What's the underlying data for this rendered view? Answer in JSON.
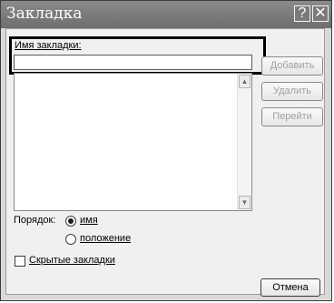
{
  "window": {
    "title": "Закладка",
    "help_glyph": "?",
    "close_glyph": "✕"
  },
  "bookmark_name": {
    "label": "Имя закладки:",
    "value": ""
  },
  "buttons": {
    "add": "Добавить",
    "delete": "Удалить",
    "goto": "Перейти",
    "cancel": "Отмена"
  },
  "sort": {
    "label": "Порядок:",
    "options": [
      {
        "label": "имя",
        "selected": true
      },
      {
        "label": "положение",
        "selected": false
      }
    ]
  },
  "hidden_bookmarks": {
    "label": "Скрытые закладки",
    "checked": false
  },
  "scrollbar": {
    "up_glyph": "▲",
    "down_glyph": "▼"
  }
}
